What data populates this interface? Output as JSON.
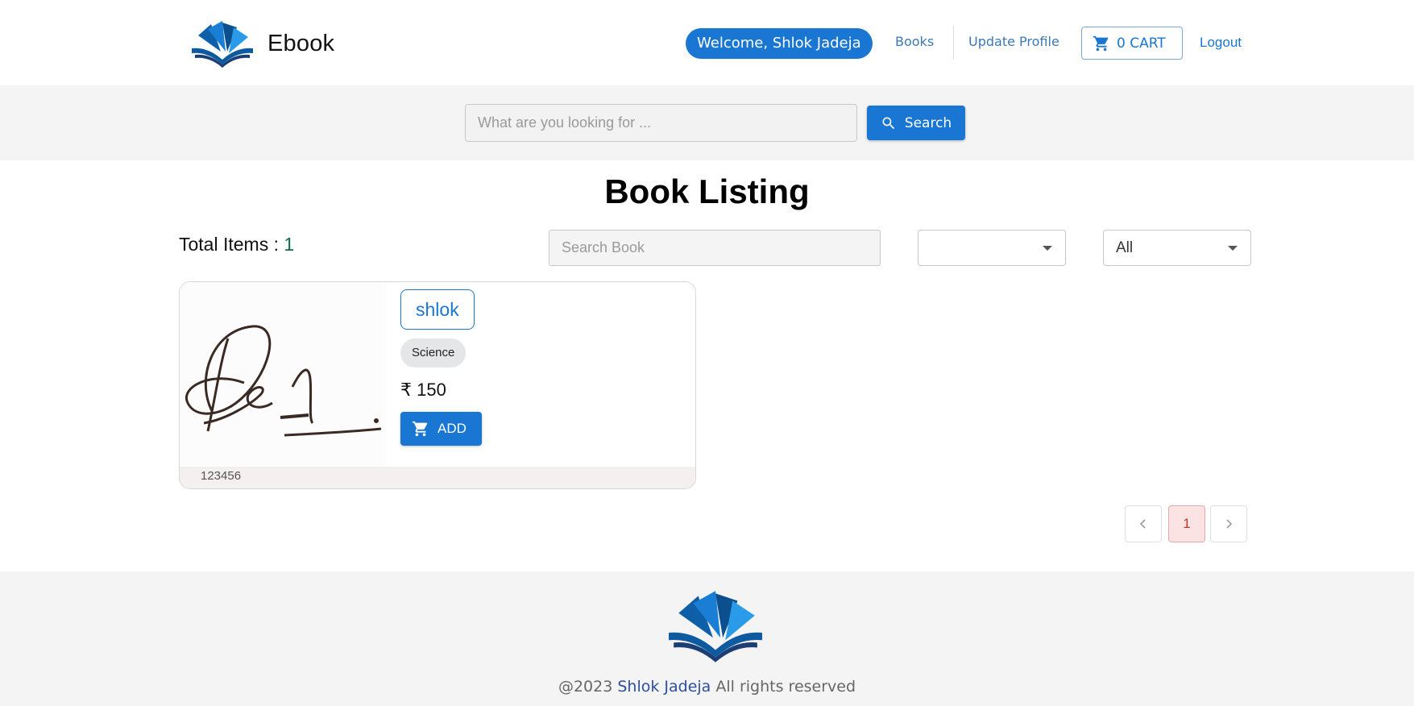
{
  "header": {
    "brand_name": "Ebook",
    "welcome": "Welcome, Shlok Jadeja",
    "nav": {
      "books": "Books",
      "update_profile": "Update Profile",
      "cart": "0 CART",
      "logout": "Logout"
    }
  },
  "search": {
    "placeholder": "What are you looking for ...",
    "button": "Search"
  },
  "main": {
    "title": "Book Listing",
    "total_label": "Total Items : ",
    "total_count": "1",
    "book_search_placeholder": "Search Book",
    "filter_1_value": "",
    "filter_2_value": "All"
  },
  "books": [
    {
      "title": "shlok",
      "category": "Science",
      "price": "₹ 150",
      "add_label": "ADD",
      "code": "123456"
    }
  ],
  "pagination": {
    "current": "1"
  },
  "footer": {
    "prefix": "@2023 ",
    "author": "Shlok Jadeja",
    "suffix": " All rights reserved"
  },
  "colors": {
    "primary": "#1976d2",
    "band": "#f4f4f4",
    "active_page_bg": "#fbe3e3"
  }
}
